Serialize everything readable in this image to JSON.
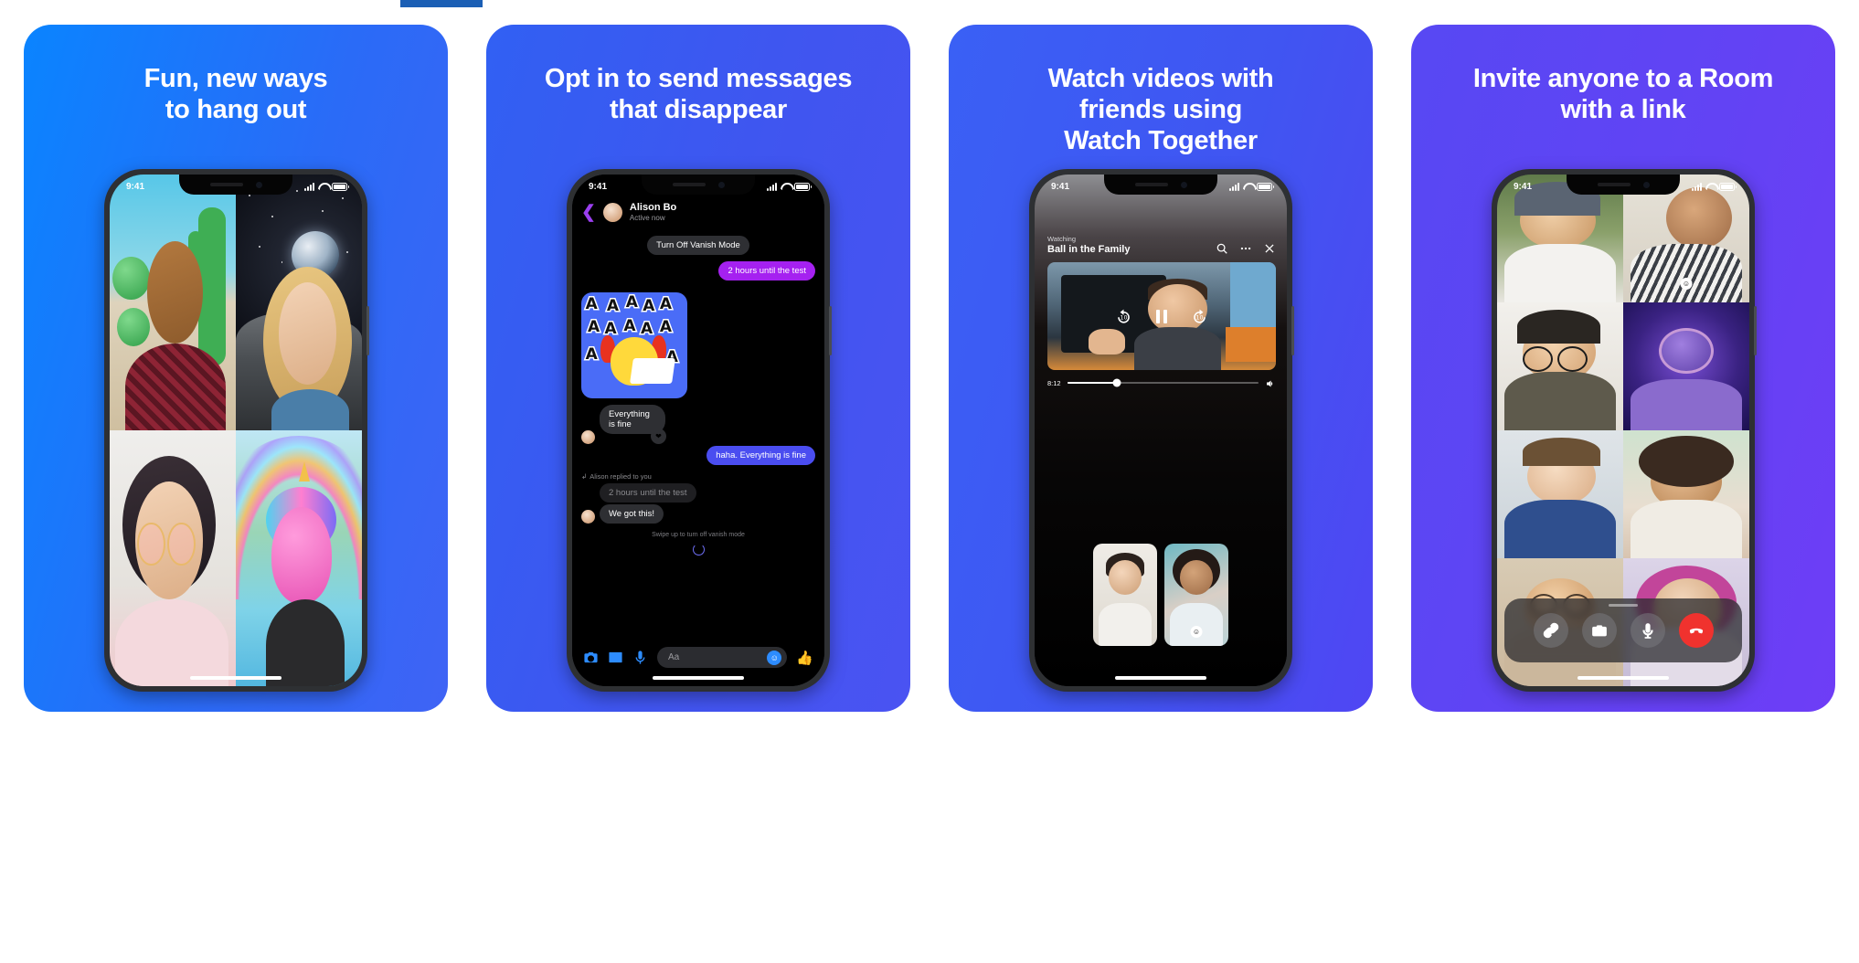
{
  "page": {
    "background": "#ffffff",
    "accent_bar_color": "#1b5fb5"
  },
  "cards": [
    {
      "id": "card-fun-ways",
      "headline": "Fun, new ways\nto hang out",
      "gradient": [
        "#0a84ff",
        "#3f63f5"
      ],
      "phone": {
        "status_bar": {
          "time": "9:41",
          "signal": "cellular-bars-icon",
          "wifi": "wifi-icon",
          "battery": "battery-full-icon"
        },
        "content_type": "video-call-grid",
        "tiles": [
          {
            "name": "cactus-ar-effect-tile",
            "effect": "cactus-balloons"
          },
          {
            "name": "moon-ar-effect-tile",
            "effect": "space-moon"
          },
          {
            "name": "glasses-ar-effect-tile",
            "effect": "pink-glasses"
          },
          {
            "name": "unicorn-ar-effect-tile",
            "effect": "unicorn-rainbow"
          }
        ]
      }
    },
    {
      "id": "card-vanish-mode",
      "headline": "Opt in to send messages\nthat disappear",
      "gradient": [
        "#3160f3",
        "#4a53f2"
      ],
      "phone": {
        "status_bar": {
          "time": "9:41"
        },
        "content_type": "chat-thread",
        "chat": {
          "back_icon": "chevron-left-icon",
          "contact_name": "Alison Bo",
          "contact_status": "Active now",
          "messages": [
            {
              "id": "msg-system",
              "text": "Turn Off Vanish Mode",
              "style": "system",
              "side": "center"
            },
            {
              "id": "msg-out-1",
              "text": "2 hours until the test",
              "style": "purple",
              "side": "right"
            },
            {
              "id": "msg-sticker",
              "text": "",
              "style": "sticker",
              "side": "left",
              "sticker_label": "AAAAAA"
            },
            {
              "id": "msg-in-1",
              "text": "Everything is fine",
              "style": "grey",
              "side": "left",
              "reaction": "❤"
            },
            {
              "id": "msg-out-2",
              "text": "haha. Everything is fine",
              "style": "blue",
              "side": "right"
            },
            {
              "id": "msg-reply-label",
              "text": "Alison replied to you",
              "style": "label",
              "side": "left"
            },
            {
              "id": "msg-quoted",
              "text": "2 hours until the test",
              "style": "faded",
              "side": "left"
            },
            {
              "id": "msg-in-2",
              "text": "We got this!",
              "style": "grey",
              "side": "left"
            }
          ],
          "swipe_hint": "Swipe up to turn off vanish mode",
          "composer": {
            "camera_icon": "camera-icon",
            "gallery_icon": "photo-gallery-icon",
            "mic_icon": "microphone-icon",
            "input_placeholder": "Aa",
            "input_value": "",
            "emoji_icon": "emoji-smiley-icon",
            "like_icon": "thumbs-up-icon"
          }
        }
      }
    },
    {
      "id": "card-watch-together",
      "headline": "Watch videos with\nfriends using\nWatch Together",
      "gradient": [
        "#3a60f5",
        "#5046f3"
      ],
      "phone": {
        "status_bar": {
          "time": "9:41"
        },
        "content_type": "watch-together",
        "watch": {
          "watching_label": "Watching",
          "video_title": "Ball in the Family",
          "search_icon": "search-icon",
          "more_icon": "more-horizontal-icon",
          "close_icon": "close-x-icon",
          "rewind_label": "10",
          "rewind_icon": "rewind-10-icon",
          "pause_icon": "pause-icon",
          "forward_label": "10",
          "forward_icon": "forward-10-icon",
          "current_time": "8:12",
          "progress_percent": 26,
          "volume_icon": "volume-icon",
          "participants": [
            {
              "name": "pip-tile-left"
            },
            {
              "name": "pip-tile-right",
              "badge": "emoji-smiley-icon"
            }
          ]
        }
      }
    },
    {
      "id": "card-rooms",
      "headline": "Invite anyone to a Room\nwith a link",
      "gradient": [
        "#5748f3",
        "#6e3df6"
      ],
      "phone": {
        "status_bar": {
          "time": "9:41"
        },
        "content_type": "room-call",
        "room": {
          "tiles": [
            {
              "name": "room-tile-1"
            },
            {
              "name": "room-tile-2",
              "badge": "emoji-smiley-icon"
            },
            {
              "name": "room-tile-3"
            },
            {
              "name": "room-tile-4"
            },
            {
              "name": "room-tile-5"
            },
            {
              "name": "room-tile-6"
            },
            {
              "name": "room-tile-7"
            },
            {
              "name": "room-tile-8"
            }
          ],
          "controls": [
            {
              "name": "share-link-button",
              "icon": "link-chain-icon"
            },
            {
              "name": "flip-camera-button",
              "icon": "camera-flip-icon"
            },
            {
              "name": "mute-button",
              "icon": "microphone-icon"
            },
            {
              "name": "end-call-button",
              "icon": "phone-hangup-icon",
              "color": "#f0322e"
            }
          ]
        }
      }
    }
  ]
}
